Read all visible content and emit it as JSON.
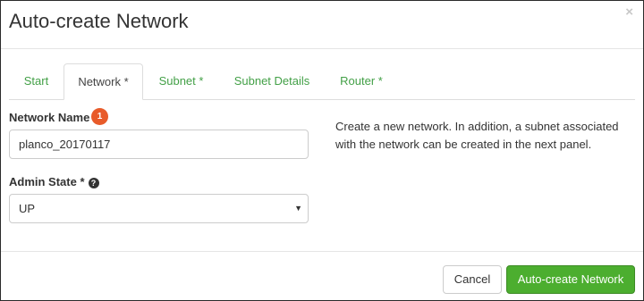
{
  "dialog": {
    "title": "Auto-create Network",
    "close_glyph": "×"
  },
  "tabs": [
    {
      "label": "Start"
    },
    {
      "label": "Network *"
    },
    {
      "label": "Subnet *"
    },
    {
      "label": "Subnet Details"
    },
    {
      "label": "Router *"
    }
  ],
  "active_tab": "Network *",
  "form": {
    "network_name": {
      "label": "Network Name",
      "badge": "1",
      "value": "planco_20170117"
    },
    "admin_state": {
      "label": "Admin State *",
      "help_icon": "?",
      "selected": "UP"
    }
  },
  "description": "Create a new network. In addition, a subnet associated with the network can be created in the next panel.",
  "footer": {
    "cancel_label": "Cancel",
    "submit_label": "Auto-create Network"
  },
  "colors": {
    "accent_green": "#4cae2f",
    "tab_link_green": "#43a047",
    "badge_orange": "#e85b2a"
  }
}
